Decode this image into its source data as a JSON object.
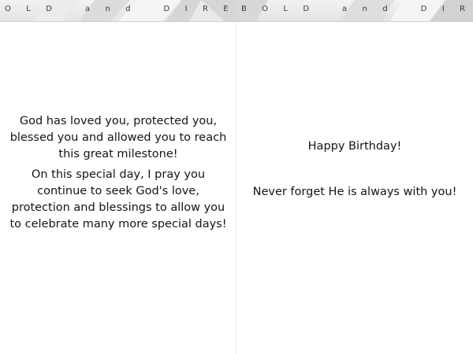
{
  "banner": {
    "left_text": "OLD and DIRECTB",
    "right_text": "BOLD and DIREC"
  },
  "left_panel": {
    "paragraph_1": "God has loved you, protected you, blessed you and allowed you to reach this great milestone!",
    "paragraph_2": "On this special day, I pray you continue to seek God's love, protection and blessings to allow you to celebrate many more special days!"
  },
  "right_panel": {
    "greeting": "Happy Birthday!",
    "message": "Never forget He is always with you!"
  },
  "colors": {
    "background": "#ffffff",
    "banner": "#e8e8e8",
    "text": "#151515"
  }
}
